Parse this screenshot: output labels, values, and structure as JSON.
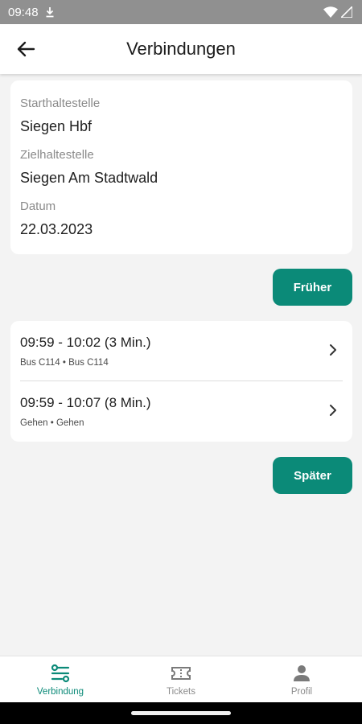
{
  "status_bar": {
    "time": "09:48",
    "icons": [
      "download-icon",
      "wifi-icon",
      "signal-icon"
    ]
  },
  "app_bar": {
    "back_icon": "arrow-left-icon",
    "title": "Verbindungen"
  },
  "search": {
    "start_label": "Starthaltestelle",
    "start_value": "Siegen Hbf",
    "destination_label": "Zielhaltestelle",
    "destination_value": "Siegen Am Stadtwald",
    "date_label": "Datum",
    "date_value": "22.03.2023"
  },
  "buttons": {
    "earlier": "Früher",
    "later": "Später"
  },
  "connections": [
    {
      "time": "09:59 - 10:02 (3 Min.)",
      "legs": "Bus C114 • Bus C114"
    },
    {
      "time": "09:59 - 10:07 (8 Min.)",
      "legs": "Gehen • Gehen"
    }
  ],
  "bottom_nav": {
    "items": [
      {
        "label": "Verbindung",
        "icon": "route-icon",
        "active": true
      },
      {
        "label": "Tickets",
        "icon": "ticket-icon",
        "active": false
      },
      {
        "label": "Profil",
        "icon": "person-icon",
        "active": false
      }
    ]
  },
  "colors": {
    "accent": "#0b8a78",
    "background": "#f3f3f3",
    "card": "#ffffff",
    "status_bar": "#909090"
  }
}
